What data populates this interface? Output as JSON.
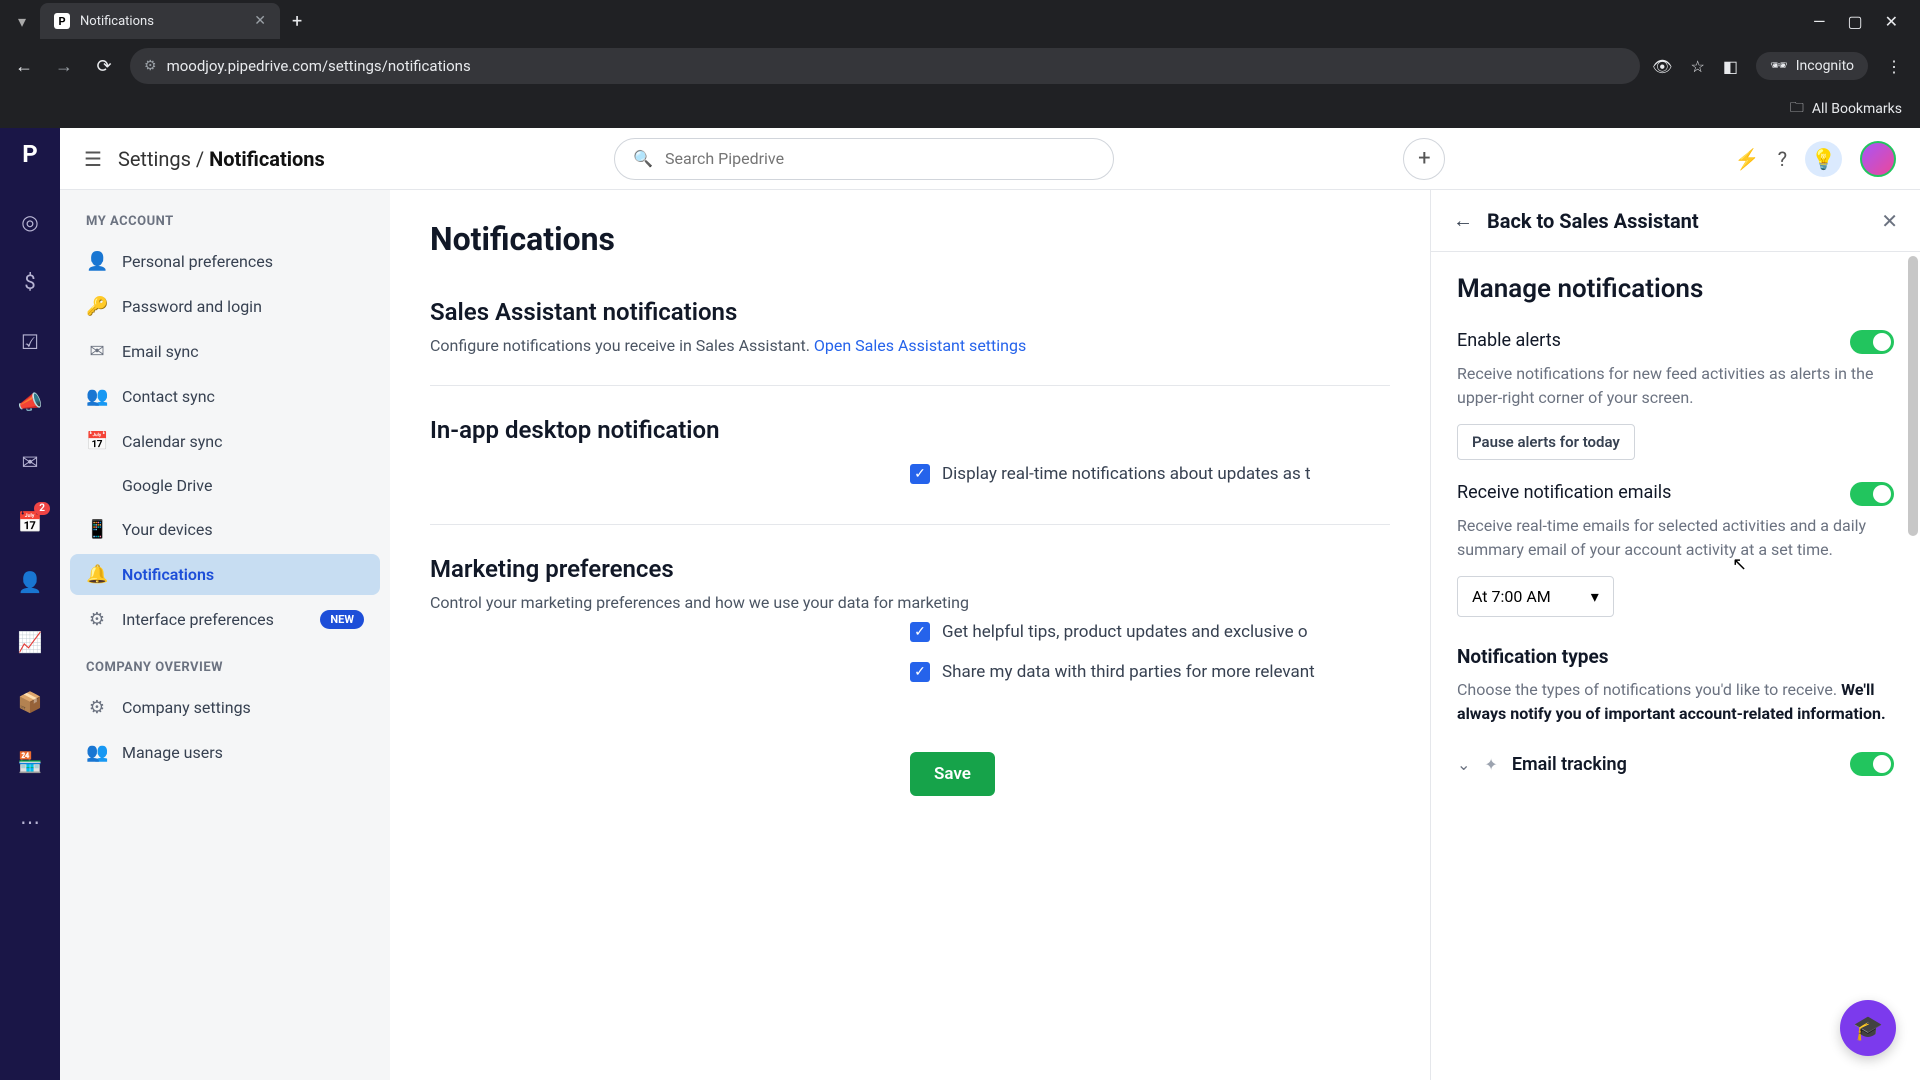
{
  "browser": {
    "tab_title": "Notifications",
    "url": "moodjoy.pipedrive.com/settings/notifications",
    "incognito_label": "Incognito",
    "all_bookmarks": "All Bookmarks"
  },
  "rail": {
    "badge_count": "2"
  },
  "topbar": {
    "breadcrumb_root": "Settings",
    "breadcrumb_sep": " / ",
    "breadcrumb_current": "Notifications",
    "search_placeholder": "Search Pipedrive"
  },
  "sidebar": {
    "group1": "MY ACCOUNT",
    "items1": [
      {
        "icon": "👤",
        "label": "Personal preferences"
      },
      {
        "icon": "🔑",
        "label": "Password and login"
      },
      {
        "icon": "✉",
        "label": "Email sync"
      },
      {
        "icon": "👥",
        "label": "Contact sync"
      },
      {
        "icon": "📅",
        "label": "Calendar sync"
      },
      {
        "icon": "gd",
        "label": "Google Drive"
      },
      {
        "icon": "📱",
        "label": "Your devices"
      },
      {
        "icon": "🔔",
        "label": "Notifications",
        "active": true
      },
      {
        "icon": "⚙",
        "label": "Interface preferences",
        "badge": "NEW"
      }
    ],
    "group2": "COMPANY OVERVIEW",
    "items2": [
      {
        "icon": "⚙",
        "label": "Company settings"
      },
      {
        "icon": "👥",
        "label": "Manage users"
      }
    ]
  },
  "main": {
    "title": "Notifications",
    "sa": {
      "title": "Sales Assistant notifications",
      "desc": "Configure notifications you receive in Sales Assistant. ",
      "link": "Open Sales Assistant settings"
    },
    "inapp": {
      "title": "In-app desktop notification",
      "check1": "Display real-time notifications about updates as t"
    },
    "marketing": {
      "title": "Marketing preferences",
      "desc": "Control your marketing preferences and how we use your data for marketing",
      "check1": "Get helpful tips, product updates and exclusive o",
      "check2": "Share my data with third parties for more relevant"
    },
    "save": "Save"
  },
  "panel": {
    "back": "Back to Sales Assistant",
    "title": "Manage notifications",
    "alerts": {
      "label": "Enable alerts",
      "desc": "Receive notifications for new feed activities as alerts in the upper-right corner of your screen.",
      "pause": "Pause alerts for today"
    },
    "emails": {
      "label": "Receive notification emails",
      "desc": "Receive real-time emails for selected activities and a daily summary email of your account activity at a set time.",
      "time": "At 7:00 AM"
    },
    "types": {
      "title": "Notification types",
      "desc_pre": "Choose the types of notifications you'd like to receive. ",
      "desc_bold": "We'll always notify you of important account-related information.",
      "item1": "Email tracking"
    }
  }
}
